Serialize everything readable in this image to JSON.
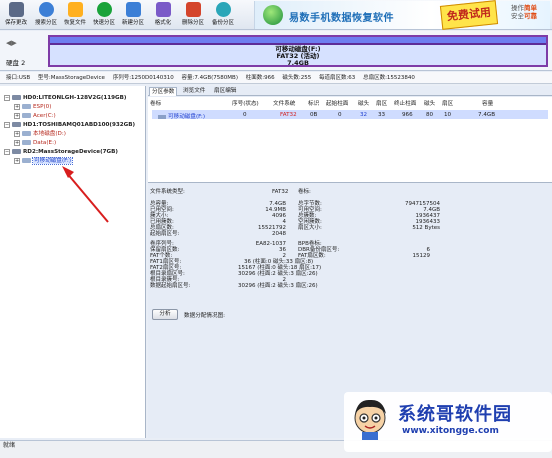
{
  "toolbar": {
    "buttons": [
      {
        "label": "保存更改",
        "icon": "floppy-icon",
        "color": "#5b6a87"
      },
      {
        "label": "搜索分区",
        "icon": "search-icon",
        "color": "#3c7fd6"
      },
      {
        "label": "恢复文件",
        "icon": "recover-icon",
        "color": "#ffb020"
      },
      {
        "label": "快速分区",
        "icon": "quick-partition-icon",
        "color": "#19a33a"
      },
      {
        "label": "新建分区",
        "icon": "new-partition-icon",
        "color": "#3c7fd6"
      },
      {
        "label": "格式化",
        "icon": "format-icon",
        "color": "#7a5ac8"
      },
      {
        "label": "删除分区",
        "icon": "delete-icon",
        "color": "#d4452c"
      },
      {
        "label": "备份分区",
        "icon": "backup-icon",
        "color": "#2aa6b8"
      }
    ]
  },
  "banner": {
    "text": "易数手机数据恢复软件",
    "badge": "免费试用",
    "right_line1_prefix": "操作",
    "right_line1_hl": "简单",
    "right_line2_prefix": "安全",
    "right_line2_hl": "可靠"
  },
  "diskbar": {
    "disk_label": "硬盘 2",
    "nav": "◀▶",
    "partition_line1": "可移动磁盘(F:)",
    "partition_line2": "FAT32 (活动)",
    "partition_line3": "7.4GB"
  },
  "infoline": {
    "items": [
      "接口:USB",
      "型号:MassStorageDevice",
      "序列号:1250D0140310",
      "容量:7.4GB(7580MB)",
      "柱面数:966",
      "磁头数:255",
      "每道扇区数:63",
      "总扇区数:15523840"
    ]
  },
  "tree": {
    "disk0": "HD0:LITEONLGH-128V2G(119GB)",
    "disk0_parts": [
      "ESP(0)",
      "Acer(C:)"
    ],
    "disk1": "HD1:TOSHIBAMQ01ABD100(932GB)",
    "disk1_parts": [
      "本地磁盘(D:)",
      "Data(E:)"
    ],
    "disk2": "RD2:MassStorageDevice(7GB)",
    "disk2_parts": [
      "可移动磁盘(F:)"
    ]
  },
  "tabs": [
    "分区参数",
    "浏览文件",
    "扇区编辑"
  ],
  "partition_table": {
    "headers": [
      "卷标",
      "序号(状态)",
      "文件系统",
      "标识",
      "起始柱面",
      "磁头",
      "扇区",
      "终止柱面",
      "磁头",
      "扇区",
      "容量"
    ],
    "row": [
      "可移动磁盘(F:)",
      "0",
      "FAT32",
      "0B",
      "0",
      "32",
      "33",
      "966",
      "80",
      "10",
      "7.4GB"
    ]
  },
  "details": {
    "fs_type_label": "文件系统类型:",
    "fs_type_value": "FAT32",
    "volume_label_label": "卷标:",
    "left1": [
      [
        "总容量:",
        "7.4GB"
      ],
      [
        "已用空间:",
        "14.9MB"
      ],
      [
        "簇大小:",
        "4096"
      ],
      [
        "已用簇数:",
        "4"
      ],
      [
        "总扇区数:",
        "15521792"
      ],
      [
        "起始扇区号:",
        "2048"
      ]
    ],
    "right1": [
      [
        "总字节数:",
        "7947157504"
      ],
      [
        "可用空间:",
        "7.4GB"
      ],
      [
        "总簇数:",
        "1936437"
      ],
      [
        "空闲簇数:",
        "1936433"
      ],
      [
        "扇区大小:",
        "512 Bytes"
      ]
    ],
    "left2": [
      [
        "卷序列号:",
        "EA82-1037"
      ],
      [
        "保留扇区数:",
        "36"
      ],
      [
        "FAT个数:",
        "2"
      ],
      [
        "FAT1扇区号:",
        "36 (柱面:0 磁头:33 扇区:8)"
      ],
      [
        "FAT2扇区号:",
        "15167 (柱面:0 磁头:18 扇区:17)"
      ],
      [
        "根目录扇区号:",
        "30296 (柱面:2 磁头:3 扇区:26)"
      ],
      [
        "根目录簇号:",
        "2"
      ],
      [
        "数据起始扇区号:",
        "30296 (柱面:2 磁头:3 扇区:26)"
      ]
    ],
    "right2": [
      [
        "BPB卷标:",
        ""
      ],
      [
        "DBR备份扇区号:",
        "6"
      ],
      [
        "FAT扇区数:",
        "15129"
      ]
    ]
  },
  "analyze_button": "分析",
  "alloc_label": "数据分配情况图:",
  "status": "就绪",
  "watermark": {
    "title": "系统哥软件园",
    "url": "www.xitongge.com"
  }
}
